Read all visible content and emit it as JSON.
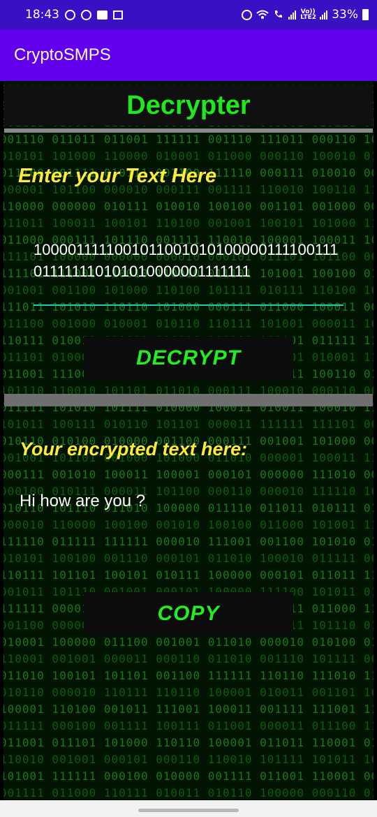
{
  "status_bar": {
    "time": "18:43",
    "battery": "33%",
    "icons": [
      "sync-icon",
      "whatsapp-icon",
      "message-icon",
      "image-icon",
      "alarm-icon",
      "wifi-icon",
      "wifi-call-icon",
      "signal-icon",
      "volte-icon",
      "signal-icon",
      "battery-icon"
    ],
    "volte": "Vo)) LTE2"
  },
  "app_bar": {
    "title": "CryptoSMPS"
  },
  "screen": {
    "heading": "Decrypter",
    "input_prompt": "Enter your Text Here",
    "input_value": "1000011111001011001010100000111100111011111110101010000001111111",
    "decrypt_label": "DECRYPT",
    "output_prompt": "Your encrypted text here:",
    "output_value": "Hi how are you ?",
    "copy_label": "COPY"
  },
  "colors": {
    "status_bar": "#3a10c4",
    "app_bar": "#6200ee",
    "heading": "#1ee81e",
    "prompt": "#ffea3a",
    "button_text": "#22ee22",
    "input_underline": "#26c6b0"
  }
}
